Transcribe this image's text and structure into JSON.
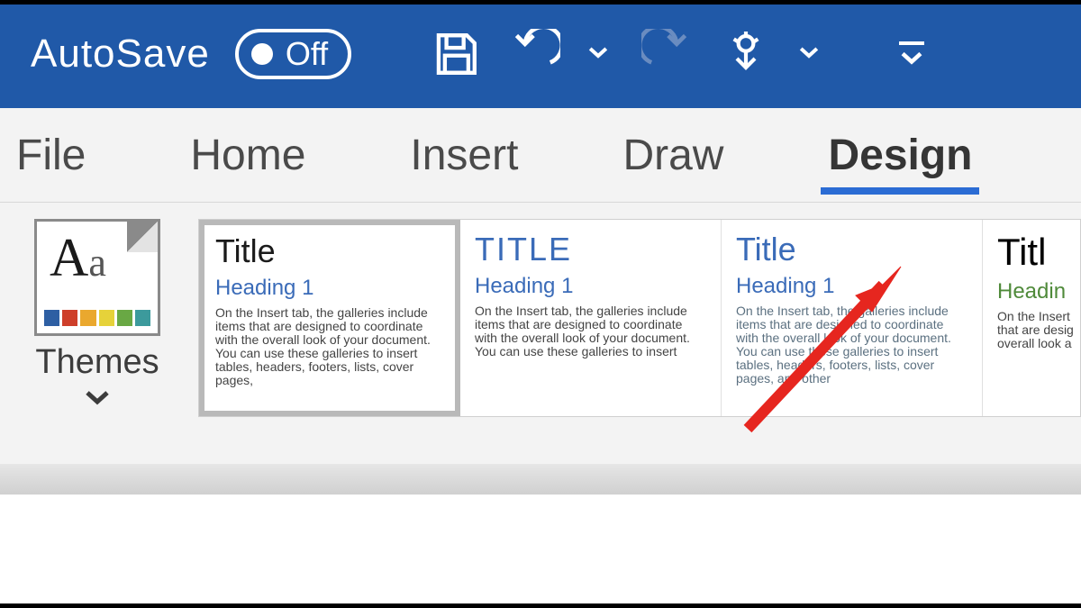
{
  "titlebar": {
    "autosave_label": "AutoSave",
    "autosave_state": "Off"
  },
  "tabs": {
    "file": "File",
    "home": "Home",
    "insert": "Insert",
    "draw": "Draw",
    "design": "Design"
  },
  "ribbon": {
    "themes_label": "Themes",
    "style_sets": [
      {
        "title": "Title",
        "heading": "Heading 1",
        "body": "On the Insert tab, the galleries include items that are designed to coordinate with the overall look of your document. You can use these galleries to insert tables, headers, footers, lists, cover pages,"
      },
      {
        "title": "TITLE",
        "heading": "Heading 1",
        "body": "On the Insert tab, the galleries include items that are designed to coordinate with the overall look of your document. You can use these galleries to insert"
      },
      {
        "title": "Title",
        "heading": "Heading 1",
        "body": "On the Insert tab, the galleries include items that are designed to coordinate with the overall look of your document. You can use these galleries to insert tables, headers, footers, lists, cover pages, and other"
      },
      {
        "title": "Titl",
        "heading": "Headin",
        "body": "On the Insert that are desig overall look a"
      }
    ]
  }
}
